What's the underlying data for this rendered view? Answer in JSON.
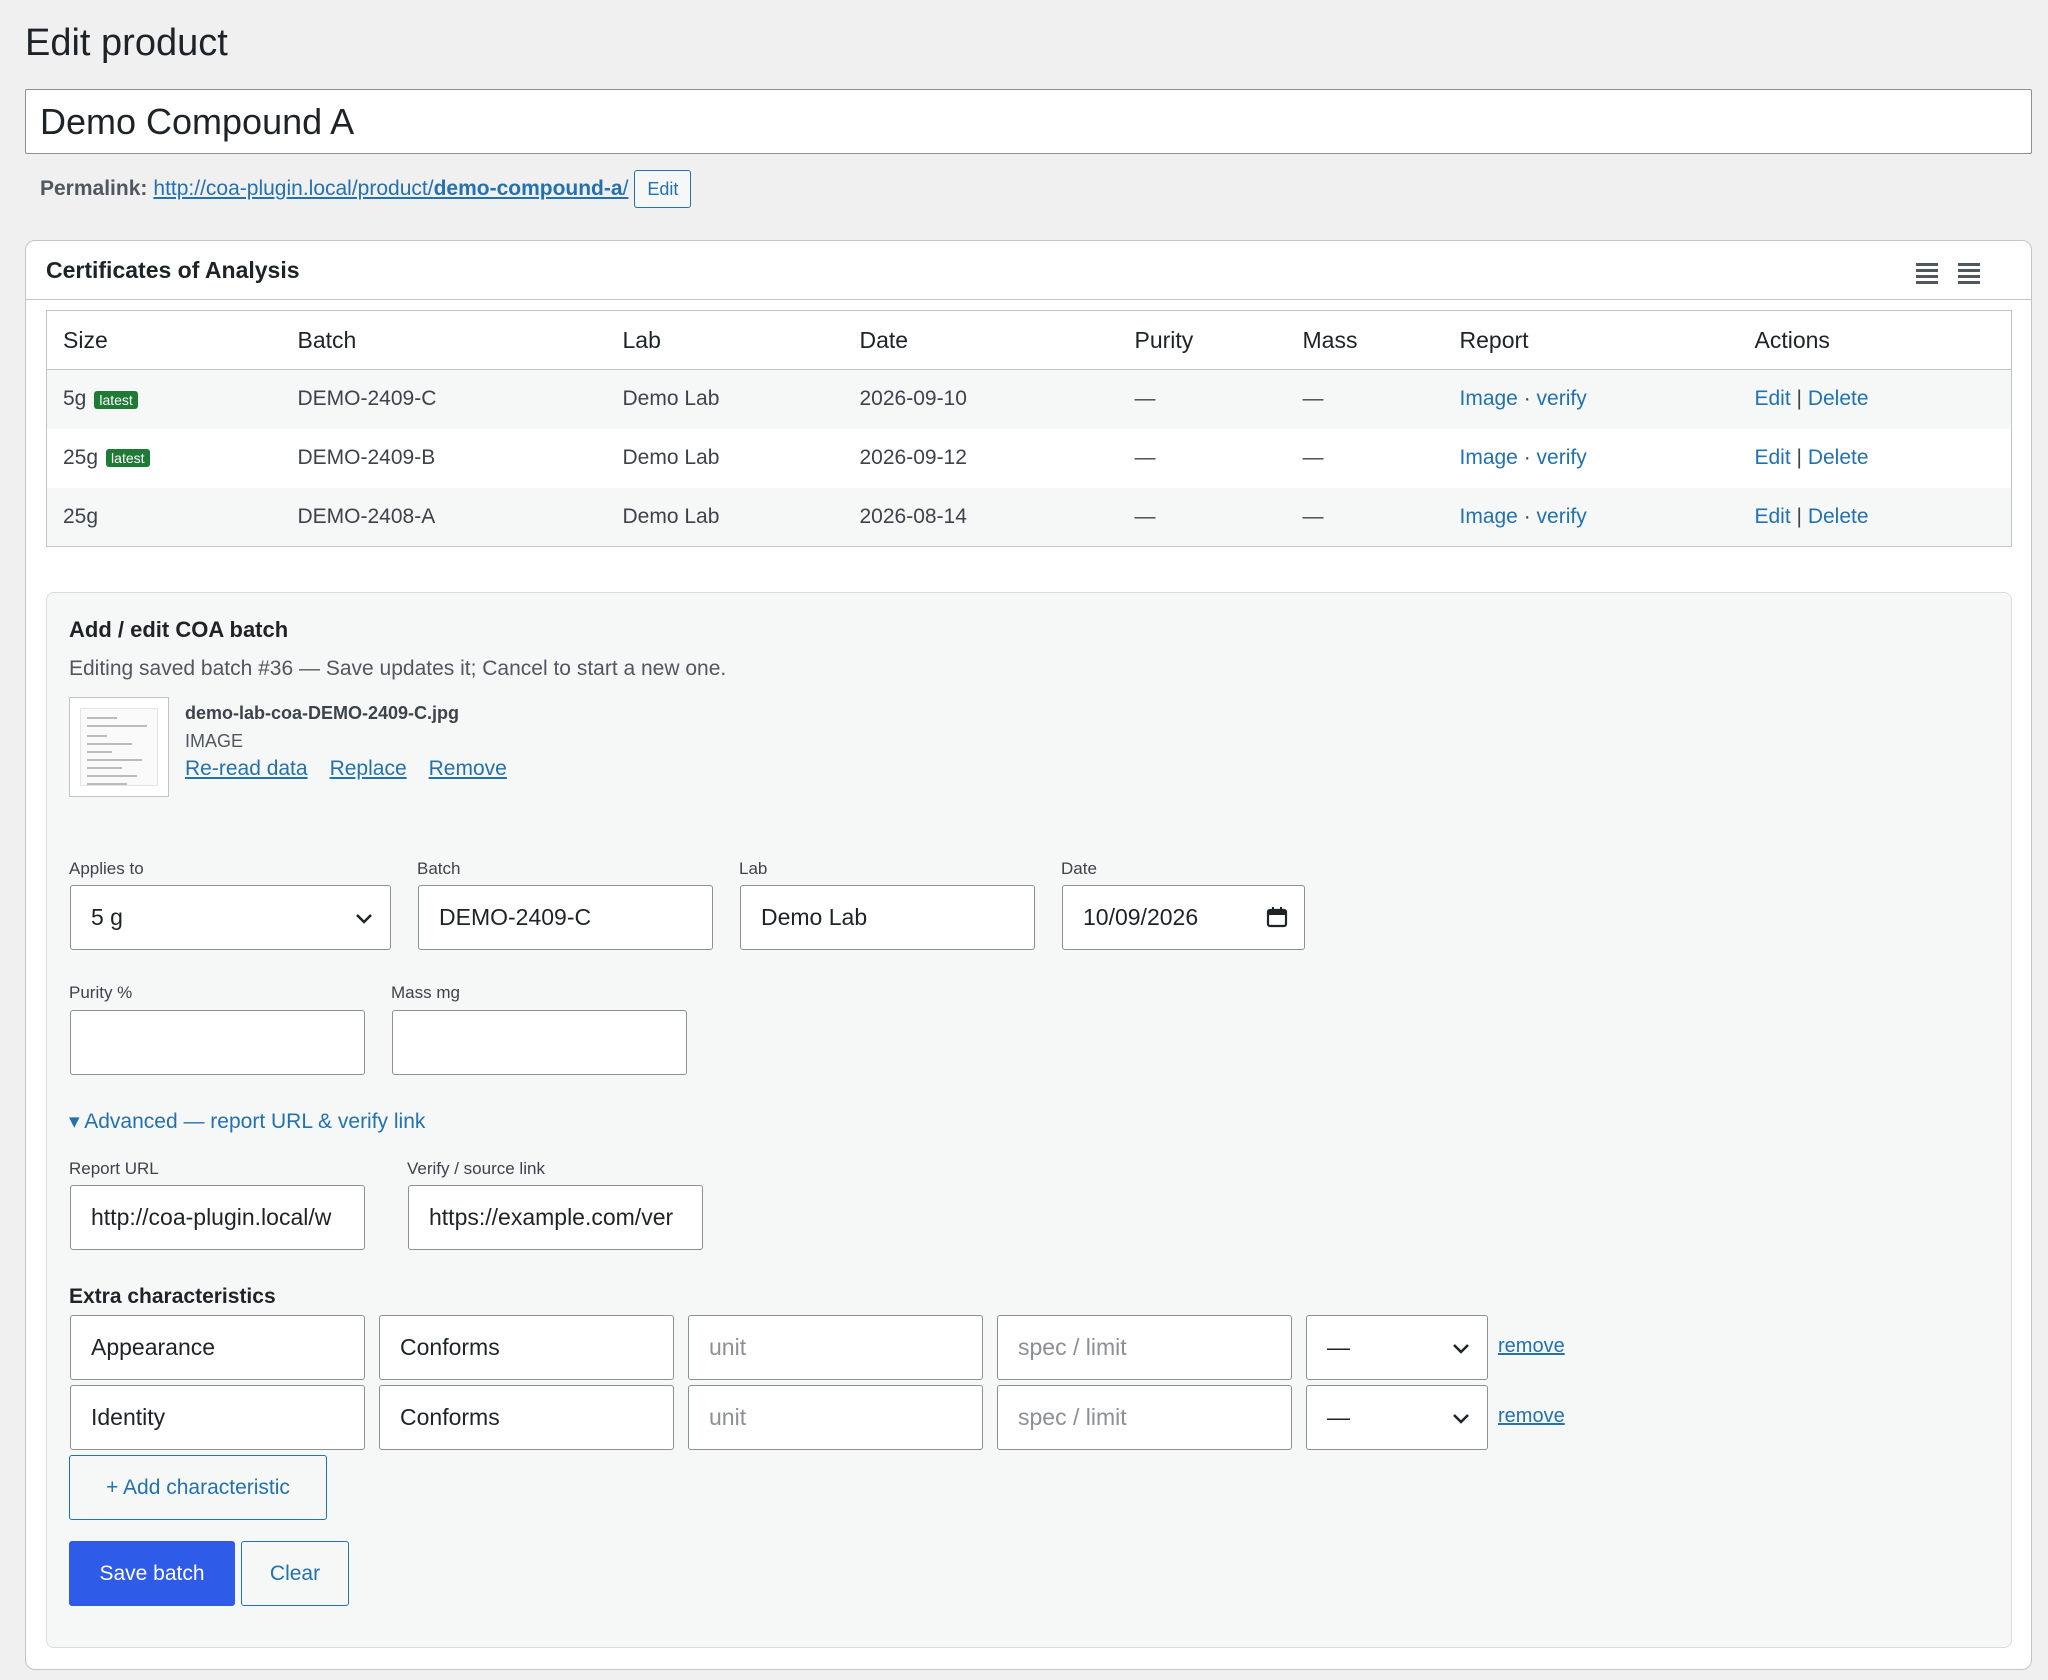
{
  "page": {
    "title": "Edit product"
  },
  "product": {
    "title": "Demo Compound A",
    "permalink_label": "Permalink:",
    "permalink_base": "http://coa-plugin.local/product/",
    "permalink_slug": "demo-compound-a",
    "permalink_trailing": "/",
    "edit_label": "Edit"
  },
  "coa": {
    "title": "Certificates of Analysis",
    "columns": [
      "Size",
      "Batch",
      "Lab",
      "Date",
      "Purity",
      "Mass",
      "Report",
      "Actions"
    ],
    "rows": [
      {
        "size": "5g",
        "badge": "latest",
        "batch": "DEMO-2409-C",
        "lab": "Demo Lab",
        "date": "2026-09-10",
        "purity": "—",
        "mass": "—",
        "report_image": "Image",
        "report_sep": " · ",
        "report_verify": "verify",
        "edit": "Edit",
        "action_sep": " | ",
        "delete": "Delete"
      },
      {
        "size": "25g",
        "badge": "latest",
        "batch": "DEMO-2409-B",
        "lab": "Demo Lab",
        "date": "2026-09-12",
        "purity": "—",
        "mass": "—",
        "report_image": "Image",
        "report_sep": " · ",
        "report_verify": "verify",
        "edit": "Edit",
        "action_sep": " | ",
        "delete": "Delete"
      },
      {
        "size": "25g",
        "badge": "",
        "batch": "DEMO-2408-A",
        "lab": "Demo Lab",
        "date": "2026-08-14",
        "purity": "—",
        "mass": "—",
        "report_image": "Image",
        "report_sep": " · ",
        "report_verify": "verify",
        "edit": "Edit",
        "action_sep": " | ",
        "delete": "Delete"
      }
    ]
  },
  "editor": {
    "title": "Add / edit COA batch",
    "note": "Editing saved batch #36 — Save updates it; Cancel to start a new one.",
    "file": {
      "name": "demo-lab-coa-DEMO-2409-C.jpg",
      "type": "IMAGE",
      "reread": "Re-read data",
      "replace": "Replace",
      "remove": "Remove"
    },
    "applies_to": {
      "label": "Applies to",
      "value": "5 g"
    },
    "batch": {
      "label": "Batch",
      "value": "DEMO-2409-C"
    },
    "lab": {
      "label": "Lab",
      "value": "Demo Lab"
    },
    "date": {
      "label": "Date",
      "value": "10/09/2026"
    },
    "purity": {
      "label": "Purity %",
      "value": ""
    },
    "mass": {
      "label": "Mass mg",
      "value": ""
    },
    "advanced_toggle": "▾ Advanced — report URL & verify link",
    "report_url": {
      "label": "Report URL",
      "value": "http://coa-plugin.local/w"
    },
    "verify_link": {
      "label": "Verify / source link",
      "value": "https://example.com/ver"
    },
    "extra_title": "Extra characteristics",
    "characteristics": [
      {
        "name": "Appearance",
        "result": "Conforms",
        "unit_placeholder": "unit",
        "spec_placeholder": "spec / limit",
        "select": "—",
        "remove": "remove"
      },
      {
        "name": "Identity",
        "result": "Conforms",
        "unit_placeholder": "unit",
        "spec_placeholder": "spec / limit",
        "select": "—",
        "remove": "remove"
      }
    ],
    "add_characteristic": "+ Add characteristic",
    "save": "Save batch",
    "clear": "Clear"
  },
  "icons": [
    "chevron-down-icon",
    "calendar-icon",
    "drag-handle-icon"
  ]
}
